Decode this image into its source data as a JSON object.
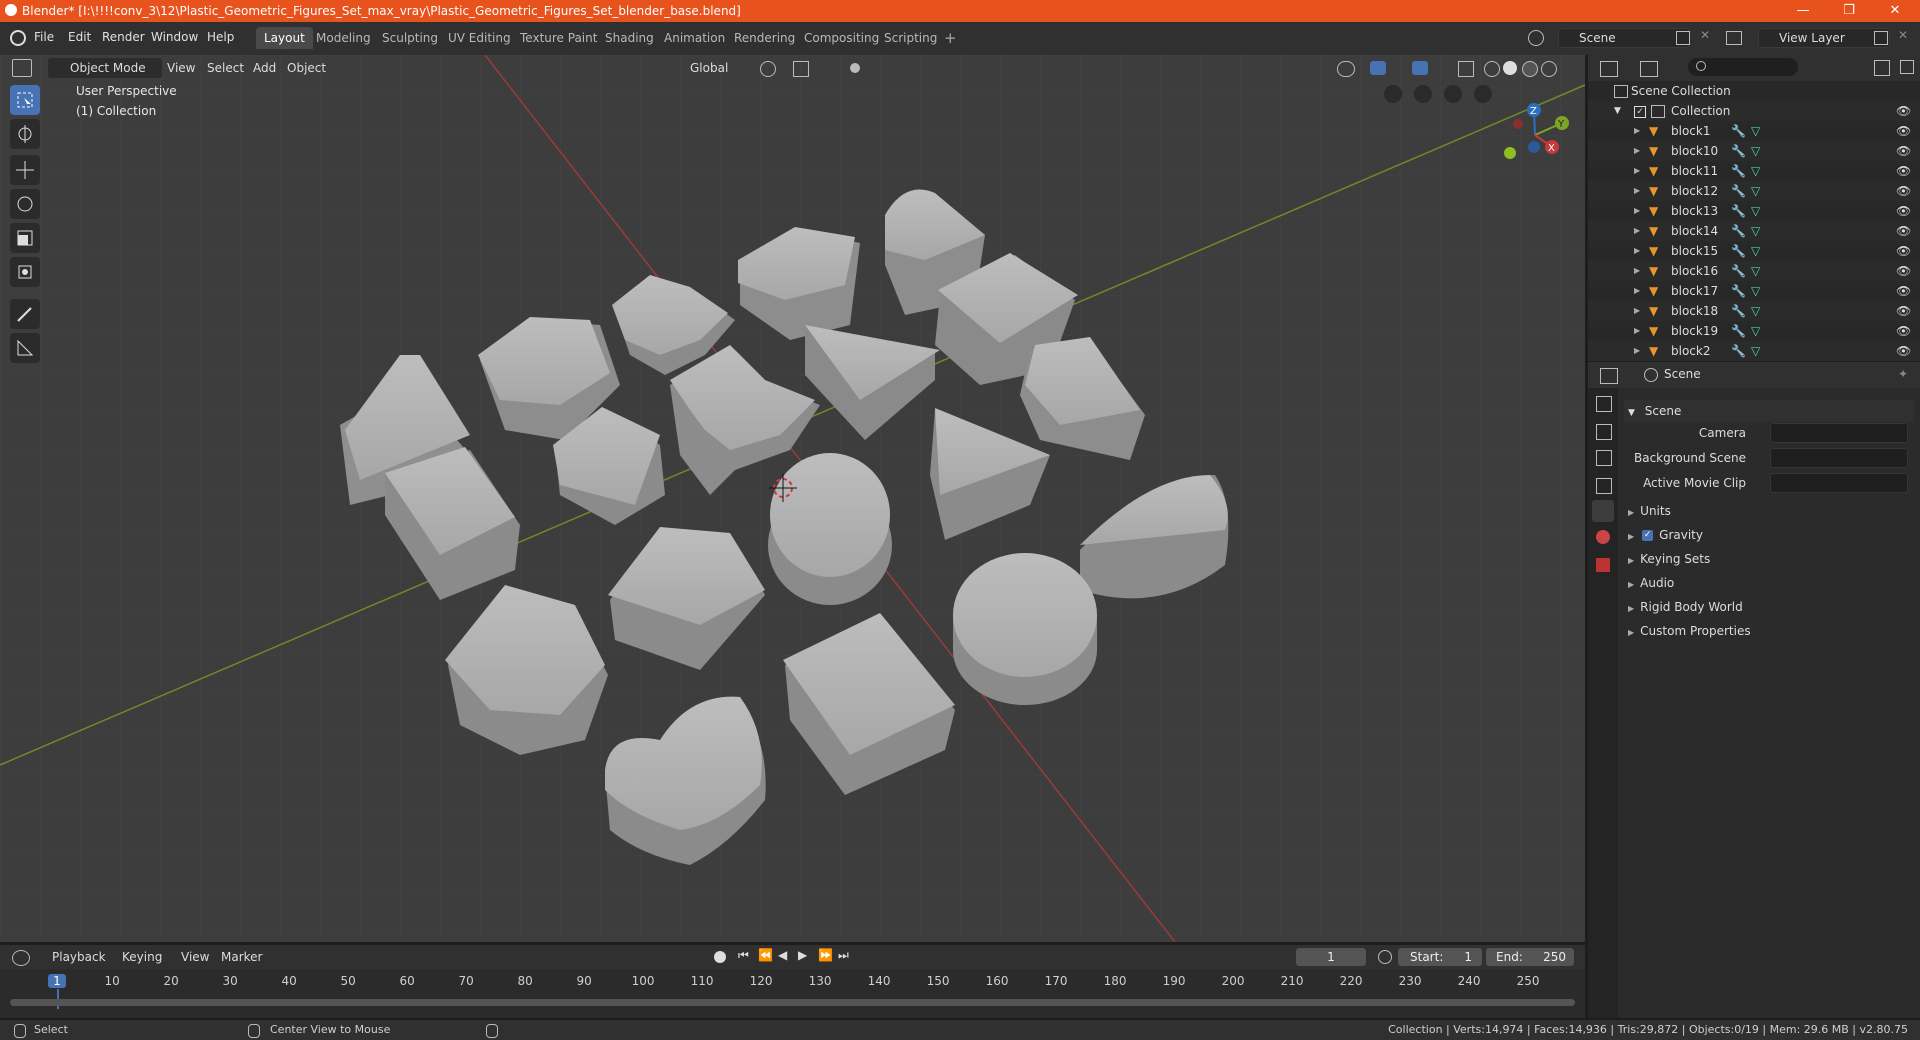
{
  "window": {
    "title": "Blender* [I:\\!!!!conv_3\\12\\Plastic_Geometric_Figures_Set_max_vray\\Plastic_Geometric_Figures_Set_blender_base.blend]",
    "accent": "#e8521c"
  },
  "menubar": {
    "menus": [
      "File",
      "Edit",
      "Render",
      "Window",
      "Help"
    ],
    "workspaces": [
      "Layout",
      "Modeling",
      "Sculpting",
      "UV Editing",
      "Texture Paint",
      "Shading",
      "Animation",
      "Rendering",
      "Compositing",
      "Scripting"
    ],
    "active_workspace": "Layout",
    "scene": "Scene",
    "view_layer": "View Layer"
  },
  "viewport": {
    "mode": "Object Mode",
    "menus": [
      "View",
      "Select",
      "Add",
      "Object"
    ],
    "transform_orientation": "Global",
    "info_line1": "User Perspective",
    "info_line2": "(1) Collection",
    "gizmo": {
      "z": "Z",
      "y": "Y",
      "x": "X"
    }
  },
  "outliner": {
    "root": "Scene Collection",
    "collection": "Collection",
    "objects": [
      "block1",
      "block10",
      "block11",
      "block12",
      "block13",
      "block14",
      "block15",
      "block16",
      "block17",
      "block18",
      "block19",
      "block2"
    ]
  },
  "properties": {
    "context": "Scene",
    "panel_title": "Scene",
    "camera_label": "Camera",
    "background_scene_label": "Background Scene",
    "active_movie_clip_label": "Active Movie Clip",
    "panels": [
      "Units",
      "Gravity",
      "Keying Sets",
      "Audio",
      "Rigid Body World",
      "Custom Properties"
    ],
    "gravity_checked": true
  },
  "timeline": {
    "menus": [
      "Playback",
      "Keying",
      "View",
      "Marker"
    ],
    "current_frame": "1",
    "start_label": "Start:",
    "start": "1",
    "end_label": "End:",
    "end": "250",
    "ticks": [
      "1",
      "10",
      "20",
      "30",
      "40",
      "50",
      "60",
      "70",
      "80",
      "90",
      "100",
      "110",
      "120",
      "130",
      "140",
      "150",
      "160",
      "170",
      "180",
      "190",
      "200",
      "210",
      "220",
      "230",
      "240",
      "250"
    ]
  },
  "statusbar": {
    "left": "Select",
    "middle": "Center View to Mouse",
    "stats": "Collection | Verts:14,974 | Faces:14,936 | Tris:29,872 | Objects:0/19 | Mem: 29.6 MB | v2.80.75"
  }
}
